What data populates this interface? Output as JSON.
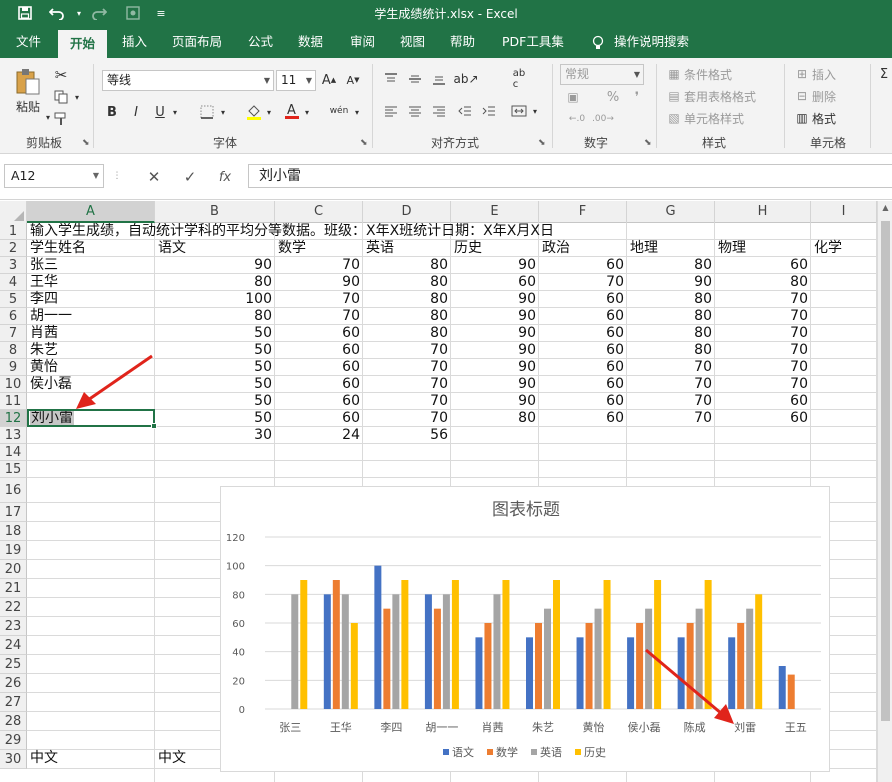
{
  "window": {
    "title": "学生成绩统计.xlsx  -  Excel"
  },
  "tabs": [
    "文件",
    "开始",
    "插入",
    "页面布局",
    "公式",
    "数据",
    "审阅",
    "视图",
    "帮助",
    "PDF工具集",
    "操作说明搜索"
  ],
  "ribbon": {
    "clipboard": {
      "paste": "粘贴",
      "label": "剪贴板"
    },
    "font": {
      "name": "等线",
      "size": "11",
      "bold": "B",
      "italic": "I",
      "underline": "U",
      "phonetic": "wén",
      "label": "字体"
    },
    "alignment": {
      "label": "对齐方式"
    },
    "number": {
      "format": "常规",
      "label": "数字"
    },
    "styles": {
      "conditional": "条件格式",
      "table": "套用表格格式",
      "cell": "单元格样式",
      "label": "样式"
    },
    "cells": {
      "insert": "插入",
      "delete": "删除",
      "format": "格式",
      "label": "单元格"
    }
  },
  "formula_bar": {
    "name_box": "A12",
    "fx": "fx",
    "content": "刘小雷"
  },
  "columns": [
    "A",
    "B",
    "C",
    "D",
    "E",
    "F",
    "G",
    "H",
    "I"
  ],
  "rows": [
    "1",
    "2",
    "3",
    "4",
    "5",
    "6",
    "7",
    "8",
    "9",
    "10",
    "11",
    "12",
    "13",
    "14",
    "15",
    "16",
    "17",
    "18",
    "19",
    "20",
    "21",
    "22",
    "23",
    "24",
    "25",
    "26",
    "27",
    "28",
    "29",
    "30"
  ],
  "sheet": {
    "row1": "输入学生成绩，自动统计学科的平均分等数据。班级：X年X班统计日期：X年X月X日",
    "headers": [
      "学生姓名",
      "语文",
      "数学",
      "英语",
      "历史",
      "政治",
      "地理",
      "物理",
      "化学"
    ],
    "data": [
      [
        "张三",
        "90",
        "70",
        "80",
        "90",
        "60",
        "80",
        "60"
      ],
      [
        "王华",
        "80",
        "90",
        "80",
        "60",
        "70",
        "90",
        "80"
      ],
      [
        "李四",
        "100",
        "70",
        "80",
        "90",
        "60",
        "80",
        "70"
      ],
      [
        "胡一一",
        "80",
        "70",
        "80",
        "90",
        "60",
        "80",
        "70"
      ],
      [
        "肖茜",
        "50",
        "60",
        "80",
        "90",
        "60",
        "80",
        "70"
      ],
      [
        "朱艺",
        "50",
        "60",
        "70",
        "90",
        "60",
        "80",
        "70"
      ],
      [
        "黄怡",
        "50",
        "60",
        "70",
        "90",
        "60",
        "70",
        "70"
      ],
      [
        "侯小磊",
        "50",
        "60",
        "70",
        "90",
        "60",
        "70",
        "70"
      ],
      [
        "",
        "50",
        "60",
        "70",
        "90",
        "60",
        "70",
        "60"
      ],
      [
        "刘小雷",
        "50",
        "60",
        "70",
        "80",
        "60",
        "70",
        "60"
      ],
      [
        "",
        "30",
        "24",
        "56",
        "",
        "",
        "",
        ""
      ]
    ],
    "row30": [
      "中文",
      "中文"
    ]
  },
  "chart_data": {
    "type": "bar",
    "title": "图表标题",
    "categories": [
      "张三",
      "王华",
      "李四",
      "胡一一",
      "肖茜",
      "朱艺",
      "黄怡",
      "侯小磊",
      "陈成",
      "刘雷",
      "王五"
    ],
    "series": [
      {
        "name": "语文",
        "color": "#4472c4",
        "values": [
          null,
          80,
          100,
          80,
          50,
          50,
          50,
          50,
          50,
          50,
          30
        ]
      },
      {
        "name": "数学",
        "color": "#ed7d31",
        "values": [
          null,
          90,
          70,
          70,
          60,
          60,
          60,
          60,
          60,
          60,
          24
        ]
      },
      {
        "name": "英语",
        "color": "#a5a5a5",
        "values": [
          80,
          80,
          80,
          80,
          80,
          70,
          70,
          70,
          70,
          70,
          null
        ]
      },
      {
        "name": "历史",
        "color": "#ffc000",
        "values": [
          90,
          60,
          90,
          90,
          90,
          90,
          90,
          90,
          90,
          80,
          null
        ]
      }
    ],
    "yticks": [
      "0",
      "20",
      "40",
      "60",
      "80",
      "100",
      "120"
    ],
    "ylim": [
      0,
      120
    ],
    "grid": true,
    "legend": "bottom"
  },
  "colors": {
    "accent": "#217346",
    "annotation": "#e0241b"
  }
}
